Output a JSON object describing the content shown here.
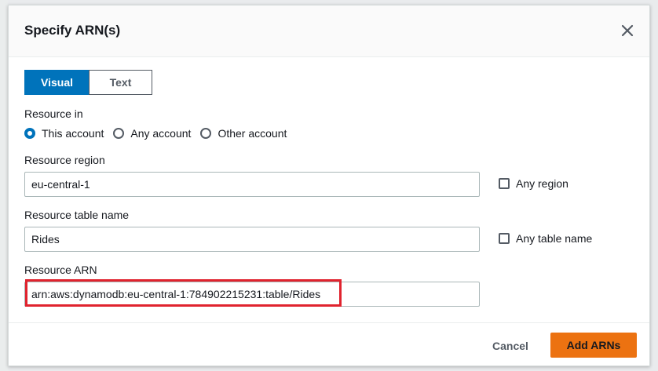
{
  "modal": {
    "title": "Specify ARN(s)"
  },
  "tabs": [
    {
      "label": "Visual",
      "active": true
    },
    {
      "label": "Text",
      "active": false
    }
  ],
  "resource_in": {
    "label": "Resource in",
    "options": [
      {
        "label": "This account",
        "checked": true
      },
      {
        "label": "Any account",
        "checked": false
      },
      {
        "label": "Other account",
        "checked": false
      }
    ]
  },
  "region": {
    "label": "Resource region",
    "value": "eu-central-1",
    "any_label": "Any region",
    "any_checked": false
  },
  "table_name": {
    "label": "Resource table name",
    "value": "Rides",
    "any_label": "Any table name",
    "any_checked": false
  },
  "arn": {
    "label": "Resource ARN",
    "value": "arn:aws:dynamodb:eu-central-1:784902215231:table/Rides"
  },
  "footer": {
    "cancel_label": "Cancel",
    "add_label": "Add ARNs"
  },
  "colors": {
    "accent": "#0073bb",
    "primary_button": "#ec7211",
    "highlight": "#e0232e"
  }
}
